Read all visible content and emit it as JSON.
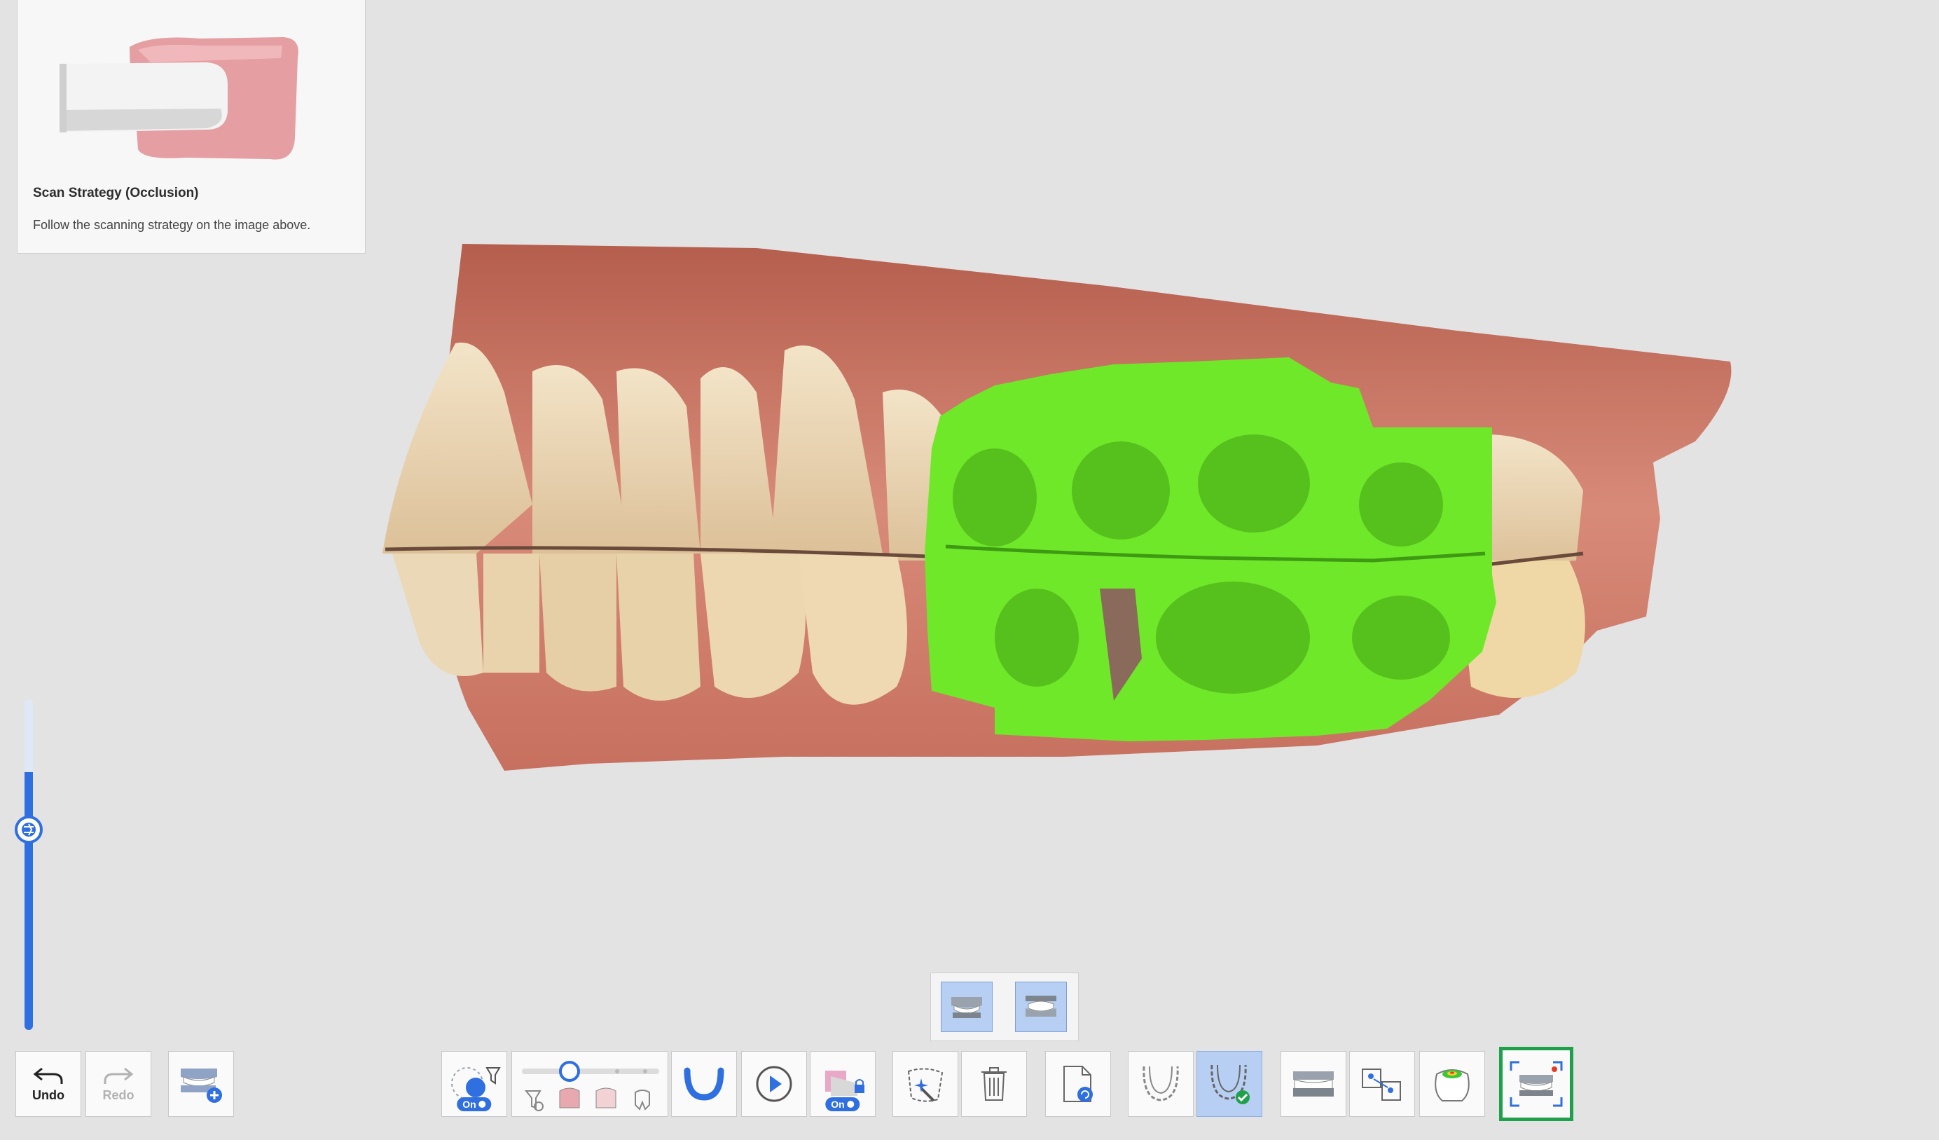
{
  "strategy": {
    "title": "Scan Strategy (Occlusion)",
    "description": "Follow the scanning strategy on the image above."
  },
  "toolbar": {
    "undo_label": "Undo",
    "redo_label": "Redo",
    "on_badge": "On"
  },
  "colors": {
    "accent": "#2f6fe0",
    "active_button": "#b7cff2",
    "highlight_frame": "#1fa04a",
    "scan_overlay": "#6fe82a"
  }
}
